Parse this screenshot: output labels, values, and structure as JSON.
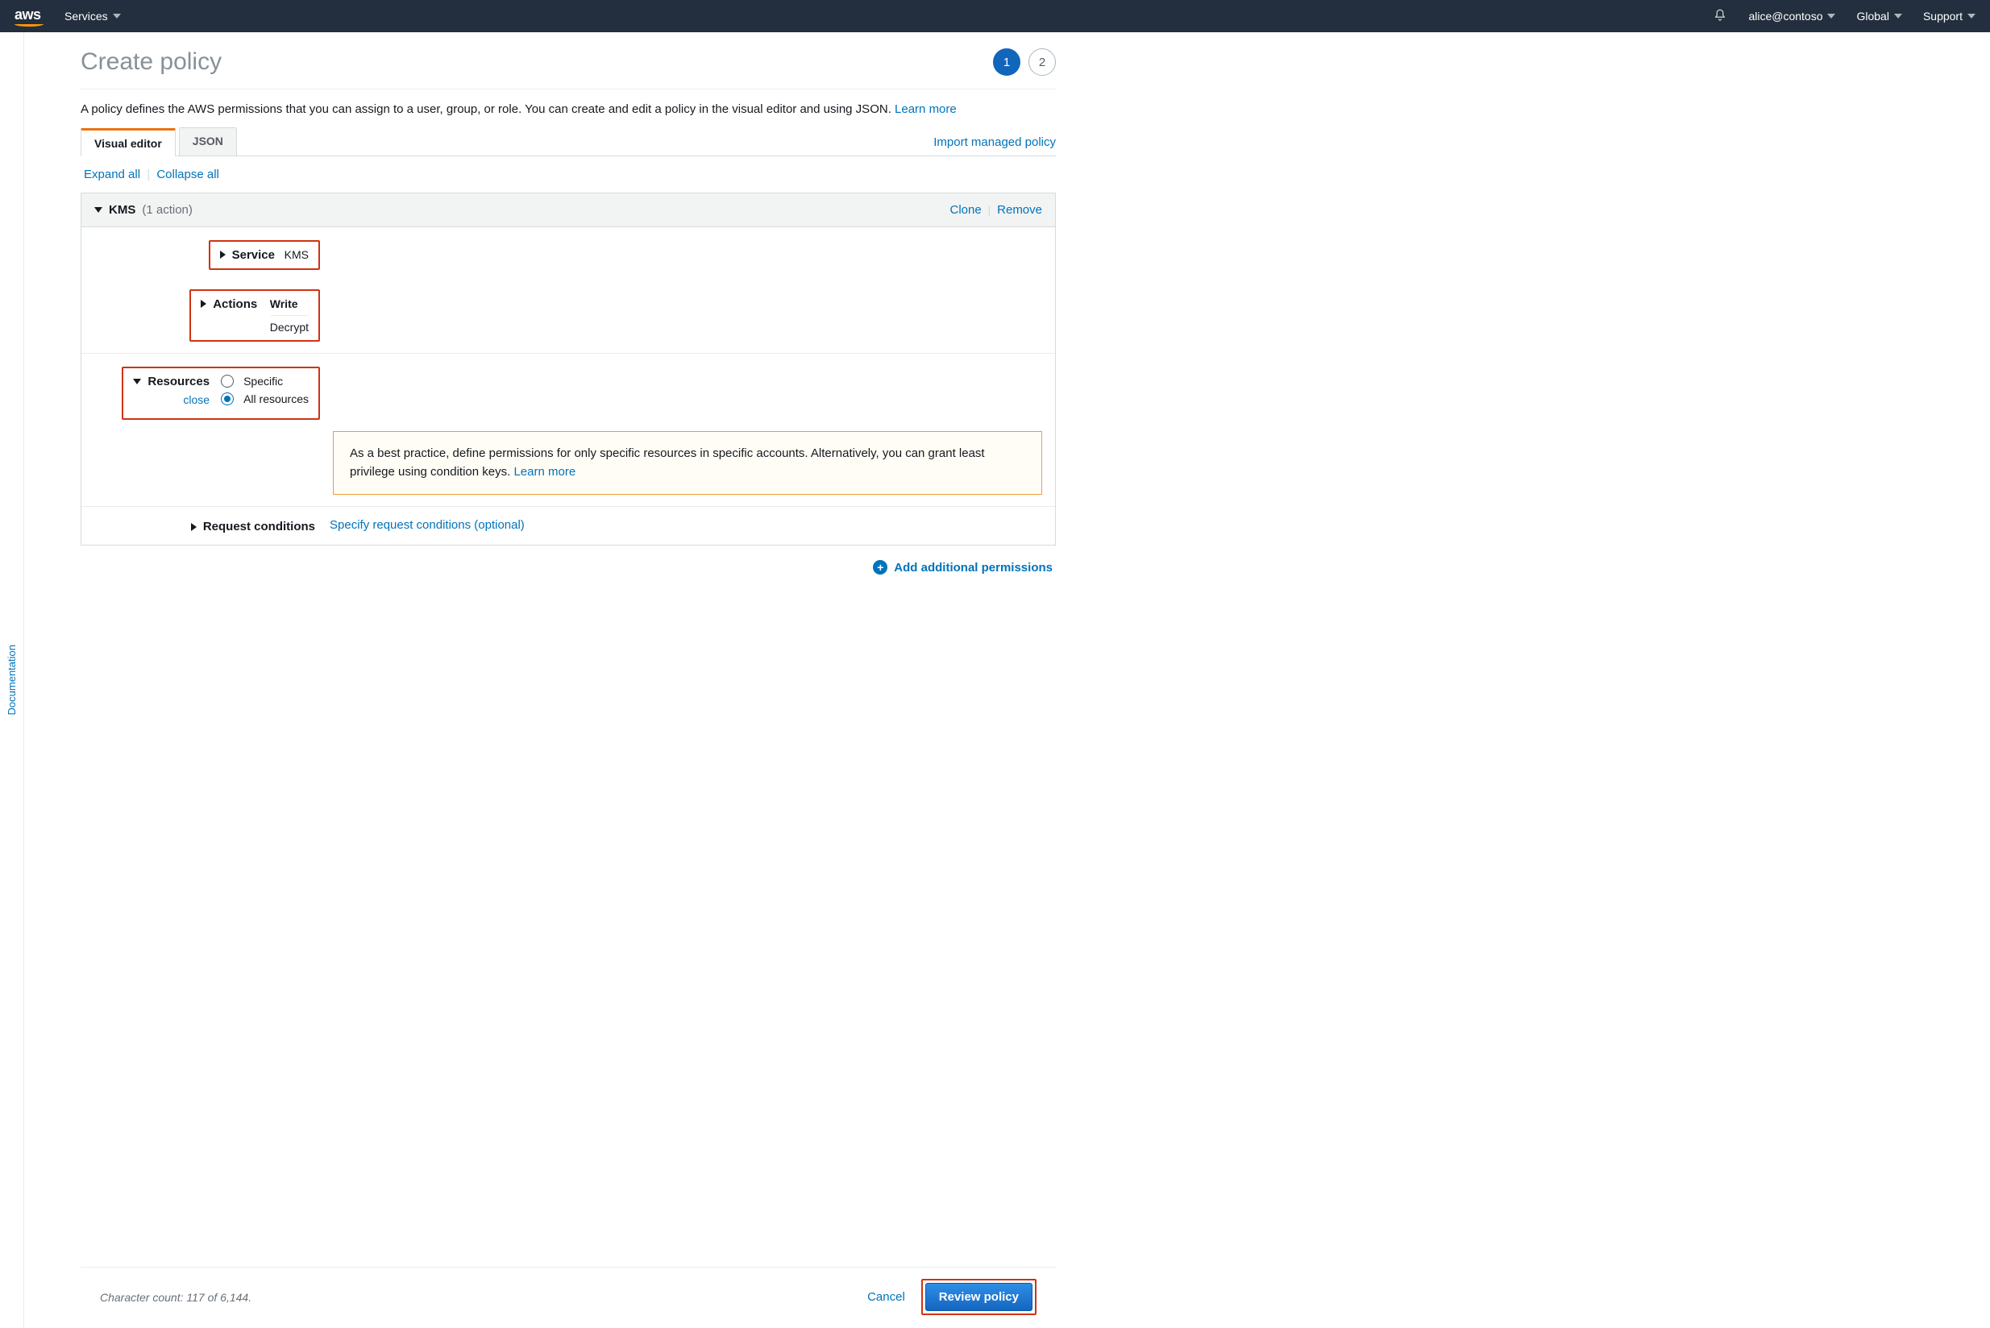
{
  "topnav": {
    "logo_text": "aws",
    "services_label": "Services",
    "account": "alice@contoso",
    "region": "Global",
    "support": "Support"
  },
  "docstrip": {
    "label": "Documentation"
  },
  "page": {
    "title": "Create policy",
    "step_current": "1",
    "step_next": "2",
    "intro_text": "A policy defines the AWS permissions that you can assign to a user, group, or role. You can create and edit a policy in the visual editor and using JSON. ",
    "learn_more": "Learn more"
  },
  "tabs": {
    "visual": "Visual editor",
    "json": "JSON",
    "import_link": "Import managed policy"
  },
  "links": {
    "expand": "Expand all",
    "collapse": "Collapse all"
  },
  "perm": {
    "header_service": "KMS",
    "header_count": "(1 action)",
    "clone": "Clone",
    "remove": "Remove",
    "service_label": "Service",
    "service_value": "KMS",
    "actions_label": "Actions",
    "actions_group": "Write",
    "actions_item": "Decrypt",
    "resources_label": "Resources",
    "resources_close": "close",
    "resource_specific": "Specific",
    "resource_all": "All resources",
    "warn_text": "As a best practice, define permissions for only specific resources in specific accounts. Alternatively, you can grant least privilege using condition keys. ",
    "warn_learn_more": "Learn more",
    "conditions_label": "Request conditions",
    "conditions_link": "Specify request conditions (optional)",
    "add_perm": "Add additional permissions"
  },
  "footer": {
    "charcount": "Character count: 117 of 6,144.",
    "cancel": "Cancel",
    "review": "Review policy"
  }
}
